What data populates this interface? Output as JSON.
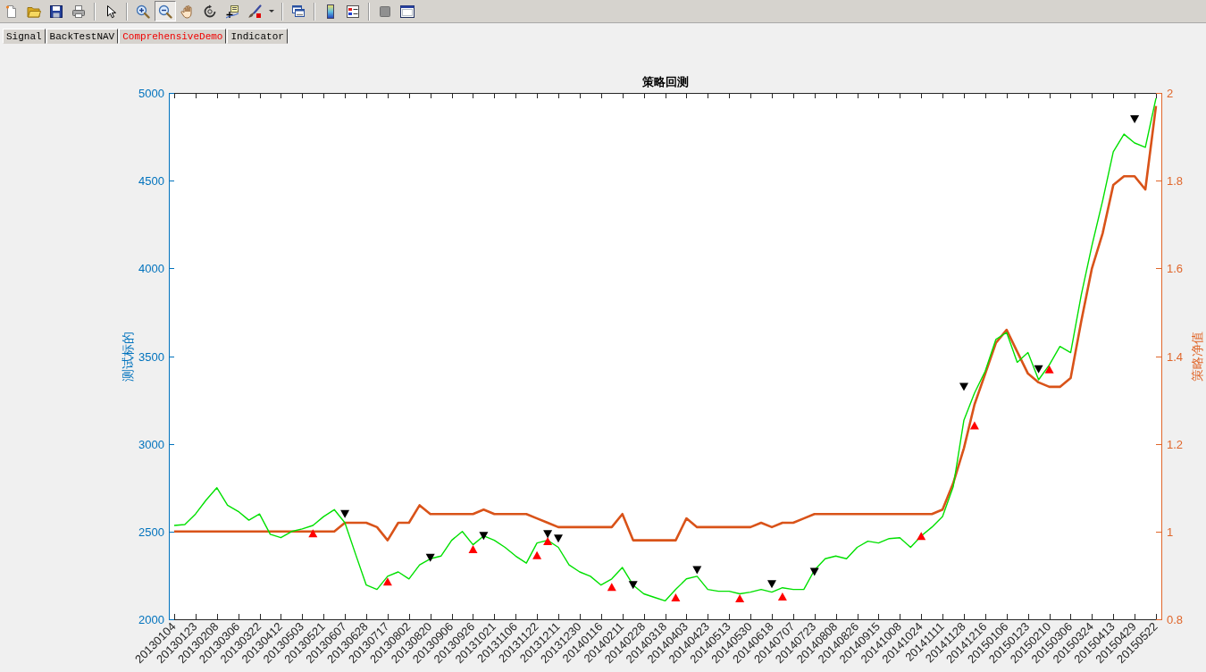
{
  "toolbar": {
    "buttons": [
      {
        "selected": false
      },
      {
        "selected": false
      },
      {
        "selected": false
      },
      {
        "selected": false
      },
      {
        "selected": false
      },
      {
        "selected": false
      },
      {
        "selected": true
      },
      {
        "selected": false
      },
      {
        "selected": false
      },
      {
        "selected": false
      },
      {
        "selected": false
      },
      {
        "selected": false
      },
      {
        "selected": false
      },
      {
        "selected": false
      },
      {
        "selected": false
      },
      {
        "selected": false
      },
      {
        "selected": false
      }
    ]
  },
  "tabs": [
    {
      "label": "Signal",
      "selected": false
    },
    {
      "label": "BackTestNAV",
      "selected": false
    },
    {
      "label": "ComprehensiveDemo",
      "selected": true
    },
    {
      "label": "Indicator",
      "selected": false
    }
  ],
  "axes": {
    "chart_data": {
      "type": "line",
      "title": "策略回测",
      "ylabel": "测试标的",
      "y2label": "策略净值",
      "categories": [
        "20130104",
        null,
        "20130123",
        null,
        "20130208",
        null,
        "20130306",
        null,
        "20130322",
        null,
        "20130412",
        null,
        "20130503",
        null,
        "20130521",
        null,
        "20130607",
        null,
        "20130628",
        null,
        "20130717",
        null,
        "20130802",
        null,
        "20130820",
        null,
        "20130906",
        null,
        "20130926",
        null,
        "20131021",
        null,
        "20131106",
        null,
        "20131122",
        null,
        "20131211",
        null,
        "20131230",
        null,
        "20140116",
        null,
        "20140211",
        null,
        "20140228",
        null,
        "20140318",
        null,
        "20140403",
        null,
        "20140423",
        null,
        "20140513",
        null,
        "20140530",
        null,
        "20140618",
        null,
        "20140707",
        null,
        "20140723",
        null,
        "20140808",
        null,
        "20140826",
        null,
        "20140915",
        null,
        "20141008",
        null,
        "20141024",
        null,
        "20141111",
        null,
        "20141128",
        null,
        "20141216",
        null,
        "20150106",
        null,
        "20150123",
        null,
        "20150210",
        null,
        "20150306",
        null,
        "20150324",
        null,
        "20150413",
        null,
        "20150429",
        null,
        "20150522"
      ],
      "ylim": [
        2000,
        5000
      ],
      "y2lim": [
        0.8,
        2
      ],
      "yticks": [
        2000,
        2500,
        3000,
        3500,
        4000,
        4500,
        5000
      ],
      "y2ticks": [
        0.8,
        1,
        1.2,
        1.4,
        1.6,
        1.8,
        2
      ],
      "series": [
        {
          "type": "line",
          "axis": "y2",
          "color": "#d95319",
          "values": [
            1,
            1,
            1,
            1,
            1,
            1,
            1,
            1,
            1,
            1,
            1,
            1,
            1,
            1,
            1,
            1,
            1.02,
            1.02,
            1.02,
            1.01,
            0.98,
            1.02,
            1.02,
            1.06,
            1.04,
            1.04,
            1.04,
            1.04,
            1.04,
            1.05,
            1.04,
            1.04,
            1.04,
            1.04,
            1.03,
            1.02,
            1.01,
            1.01,
            1.01,
            1.01,
            1.01,
            1.01,
            1.04,
            0.98,
            0.98,
            0.98,
            0.98,
            0.98,
            1.03,
            1.01,
            1.01,
            1.01,
            1.01,
            1.01,
            1.01,
            1.02,
            1.01,
            1.02,
            1.02,
            1.03,
            1.04,
            1.04,
            1.04,
            1.04,
            1.04,
            1.04,
            1.04,
            1.04,
            1.04,
            1.04,
            1.04,
            1.04,
            1.05,
            1.11,
            1.19,
            1.29,
            1.36,
            1.43,
            1.46,
            1.41,
            1.36,
            1.34,
            1.33,
            1.33,
            1.35,
            1.48,
            1.6,
            1.68,
            1.79,
            1.81,
            1.81,
            1.78,
            1.97
          ]
        },
        {
          "type": "line",
          "color": "#00e000",
          "values": [
            2535,
            2540,
            2600,
            2680,
            2750,
            2650,
            2615,
            2565,
            2600,
            2485,
            2465,
            2500,
            2515,
            2535,
            2585,
            2625,
            2550,
            2370,
            2195,
            2170,
            2245,
            2270,
            2230,
            2310,
            2345,
            2360,
            2450,
            2500,
            2425,
            2475,
            2450,
            2410,
            2360,
            2320,
            2435,
            2450,
            2410,
            2310,
            2270,
            2245,
            2195,
            2230,
            2295,
            2195,
            2145,
            2125,
            2105,
            2170,
            2230,
            2245,
            2170,
            2160,
            2160,
            2145,
            2155,
            2170,
            2155,
            2180,
            2170,
            2170,
            2280,
            2345,
            2360,
            2345,
            2410,
            2445,
            2435,
            2460,
            2465,
            2410,
            2475,
            2525,
            2585,
            2755,
            3135,
            3290,
            3415,
            3595,
            3635,
            3465,
            3520,
            3365,
            3450,
            3555,
            3520,
            3850,
            4130,
            4385,
            4665,
            4765,
            4715,
            4690,
            4970
          ]
        },
        {
          "type": "scatter",
          "marker": "triangle",
          "color": "#ff0000",
          "values": [
            null,
            null,
            null,
            null,
            null,
            null,
            null,
            null,
            null,
            null,
            null,
            null,
            null,
            2490,
            null,
            null,
            null,
            null,
            null,
            null,
            2215,
            null,
            null,
            null,
            null,
            null,
            null,
            null,
            2400,
            null,
            null,
            null,
            null,
            null,
            2365,
            2445,
            null,
            null,
            null,
            null,
            null,
            2185,
            null,
            null,
            null,
            null,
            null,
            2125,
            null,
            null,
            null,
            null,
            null,
            2120,
            null,
            null,
            null,
            2130,
            null,
            null,
            null,
            null,
            null,
            null,
            null,
            null,
            null,
            null,
            null,
            null,
            2475,
            null,
            null,
            null,
            null,
            3105,
            null,
            null,
            null,
            null,
            null,
            null,
            3425,
            null,
            null,
            null,
            null,
            null,
            null,
            null,
            null,
            null,
            null
          ]
        },
        {
          "type": "scatter",
          "marker": "triangle-down",
          "color": "#000000",
          "values": [
            null,
            null,
            null,
            null,
            null,
            null,
            null,
            null,
            null,
            null,
            null,
            null,
            null,
            null,
            null,
            null,
            2600,
            null,
            null,
            null,
            null,
            null,
            null,
            null,
            2350,
            null,
            null,
            null,
            null,
            2475,
            null,
            null,
            null,
            null,
            null,
            2485,
            2460,
            null,
            null,
            null,
            null,
            null,
            null,
            2195,
            null,
            null,
            null,
            null,
            null,
            2280,
            null,
            null,
            null,
            null,
            null,
            null,
            2200,
            null,
            null,
            null,
            2270,
            null,
            null,
            null,
            null,
            null,
            null,
            null,
            null,
            null,
            null,
            null,
            null,
            null,
            3325,
            null,
            null,
            null,
            null,
            null,
            null,
            3425,
            null,
            null,
            null,
            null,
            null,
            null,
            null,
            null,
            4850,
            null,
            null
          ]
        }
      ]
    }
  }
}
